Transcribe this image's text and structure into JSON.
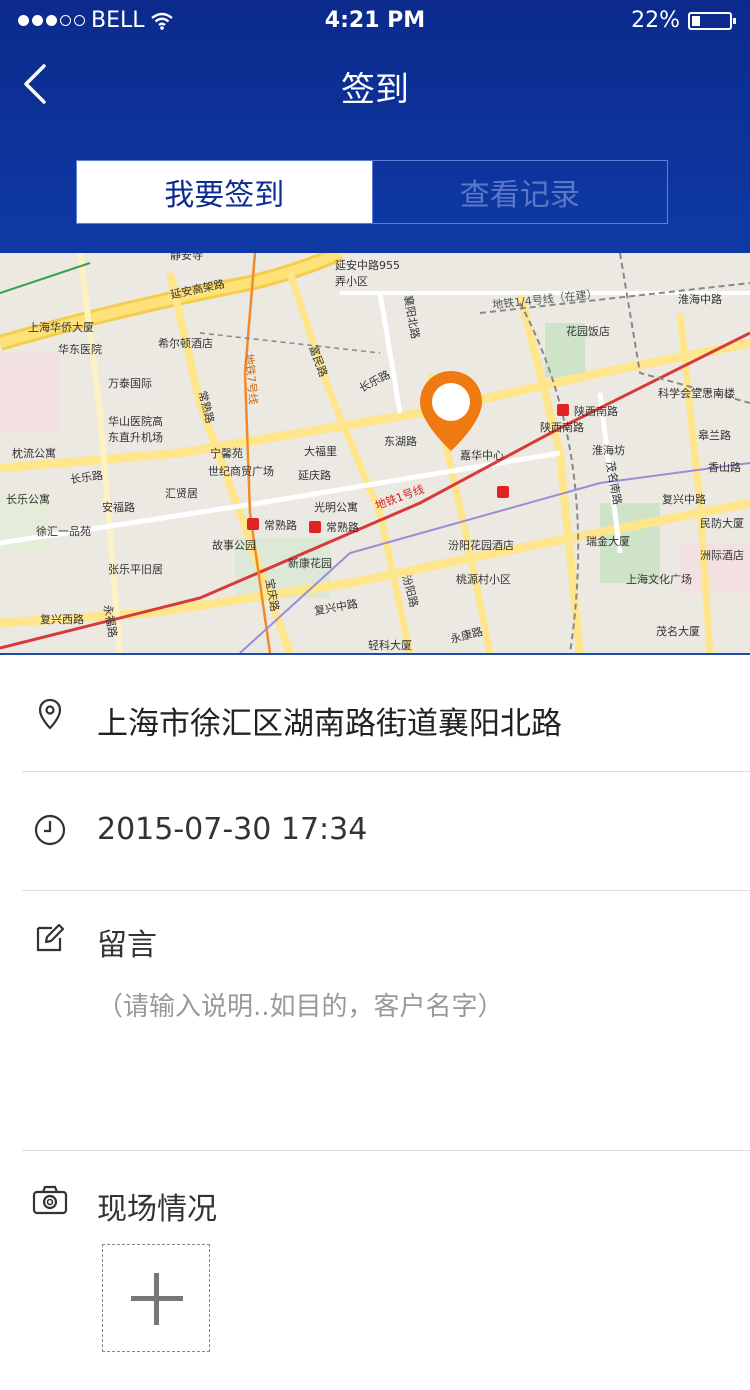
{
  "status_bar": {
    "carrier": "BELL",
    "time": "4:21 PM",
    "battery": "22%",
    "battery_level": 0.22,
    "signal_bars": 3
  },
  "nav": {
    "title": "签到",
    "back_icon": "chevron-left-icon"
  },
  "tabs": [
    {
      "label": "我要签到",
      "active": true
    },
    {
      "label": "查看记录",
      "active": false
    }
  ],
  "map": {
    "pin_color": "#f07a12",
    "labels": {
      "l1": "静安寺",
      "l2": "延安高架路",
      "l3": "延安中路955弄小区",
      "l4": "上海华侨大厦",
      "l5": "华东医院",
      "l6": "希尔顿酒店",
      "l7": "万泰国际",
      "l8": "华山医院高东直升机场",
      "l9": "枕流公寓",
      "l10": "宁馨苑",
      "l11": "世纪商贸广场",
      "l12": "大福里",
      "l13": "东湖路",
      "l14": "嘉华中心",
      "l15": "陕西南路",
      "l16": "陕西南路",
      "l17": "淮海坊",
      "l18": "科学会堂思南楼",
      "l19": "淮海中路",
      "l20": "花园饭店",
      "l21": "长乐路",
      "l22": "长乐公寓",
      "l23": "汇贤居",
      "l24": "延庆路",
      "l25": "光明公寓",
      "l26": "常熟路",
      "l27": "常熟路",
      "l28": "徐汇一品苑",
      "l29": "安福路",
      "l30": "故事公园",
      "l31": "新康花园",
      "l32": "汾阳花园酒店",
      "l33": "桃源村小区",
      "l34": "张乐平旧居",
      "l35": "复兴西路",
      "l36": "复兴中路",
      "l37": "轻科大厦",
      "l38": "永康路",
      "l39": "瑞金大厦",
      "l40": "上海文化广场",
      "l41": "茂名大厦",
      "l42": "民防大厦",
      "l43": "洲际酒店",
      "l44": "香山路",
      "l45": "皋兰路",
      "l46": "复兴中路",
      "l47": "襄阳北路",
      "l48": "富民路",
      "l49": "常熟路",
      "l50": "宝庆路",
      "l51": "永福路",
      "l52": "茂名南路",
      "l53": "地铁1号线",
      "l54": "地铁1/4号线（在建）",
      "l55": "地铁7号线",
      "l56": "汾阳路",
      "l57": "长乐路"
    }
  },
  "location": {
    "icon": "location-pin-icon",
    "address": "上海市徐汇区湖南路街道襄阳北路"
  },
  "time": {
    "icon": "clock-icon",
    "value": "2015-07-30 17:34"
  },
  "message": {
    "icon": "edit-icon",
    "label": "留言",
    "placeholder": "（请输入说明..如目的，客户名字）"
  },
  "photo": {
    "icon": "camera-icon",
    "label": "现场情况",
    "add_icon": "plus-icon"
  }
}
